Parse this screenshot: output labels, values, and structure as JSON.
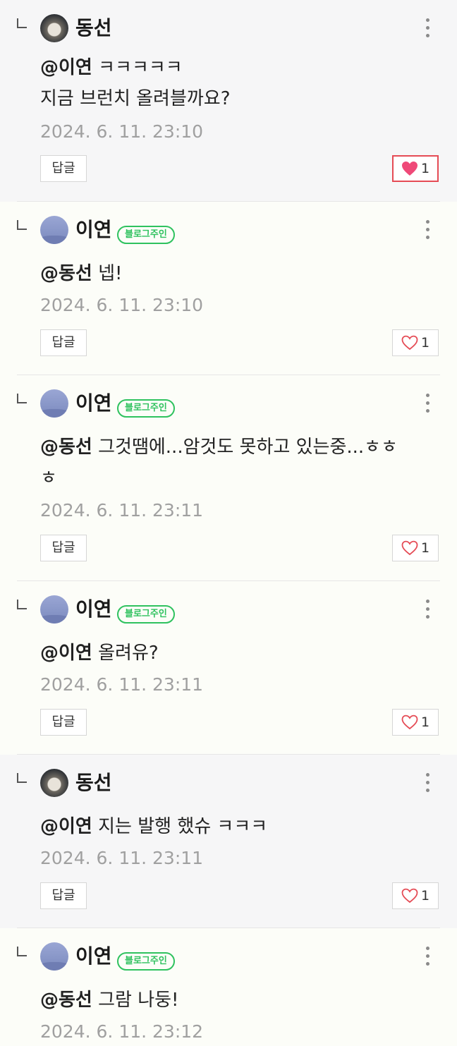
{
  "comments": [
    {
      "author": "동선",
      "owner": false,
      "mention": "@이연",
      "text": " ㅋㅋㅋㅋㅋ",
      "text2": "지금 브런치 올려블까요?",
      "date": "2024. 6. 11. 23:10",
      "reply_label": "답글",
      "likes": "1",
      "liked": true,
      "bg": "gray"
    },
    {
      "author": "이연",
      "owner": true,
      "badge": "블로그주인",
      "mention": "@동선",
      "text": " 넵!",
      "date": "2024. 6. 11. 23:10",
      "reply_label": "답글",
      "likes": "1",
      "liked": false,
      "bg": "cream"
    },
    {
      "author": "이연",
      "owner": true,
      "badge": "블로그주인",
      "mention": "@동선",
      "text": " 그것땜에...암것도 못하고 있는중...ㅎㅎ",
      "text2": "ㅎ",
      "date": "2024. 6. 11. 23:11",
      "reply_label": "답글",
      "likes": "1",
      "liked": false,
      "bg": "cream"
    },
    {
      "author": "이연",
      "owner": true,
      "badge": "블로그주인",
      "mention": "@이연",
      "text": " 올려유?",
      "date": "2024. 6. 11. 23:11",
      "reply_label": "답글",
      "likes": "1",
      "liked": false,
      "bg": "cream"
    },
    {
      "author": "동선",
      "owner": false,
      "mention": "@이연",
      "text": " 지는 발행 했슈 ㅋㅋㅋ",
      "date": "2024. 6. 11. 23:11",
      "reply_label": "답글",
      "likes": "1",
      "liked": false,
      "bg": "gray"
    },
    {
      "author": "이연",
      "owner": true,
      "badge": "블로그주인",
      "mention": "@동선",
      "text": " 그람 나둥!",
      "date": "2024. 6. 11. 23:12",
      "bg": "cream"
    }
  ],
  "colors": {
    "like_active": "#e54b55",
    "badge": "#2fc25f",
    "date": "#a0a0a0"
  }
}
